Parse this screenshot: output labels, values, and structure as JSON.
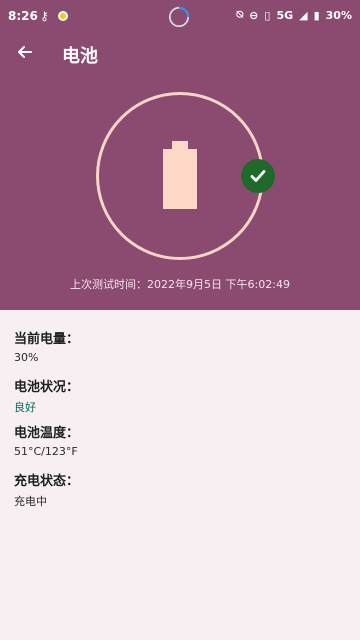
{
  "status_bar": {
    "time": "8:26",
    "key_icon": "key-icon",
    "battery_percent": "30%"
  },
  "header": {
    "title": "电池",
    "last_test": "上次测试时间：2022年9月5日 下午6:02:49"
  },
  "battery_info": {
    "level_label": "当前电量：",
    "level_value": "30%",
    "health_label": "电池状况：",
    "health_value": "良好",
    "temperature_label": "电池温度：",
    "temperature_value": "51°C/123°F",
    "charging_label": "充电状态：",
    "charging_value": "充电中"
  }
}
